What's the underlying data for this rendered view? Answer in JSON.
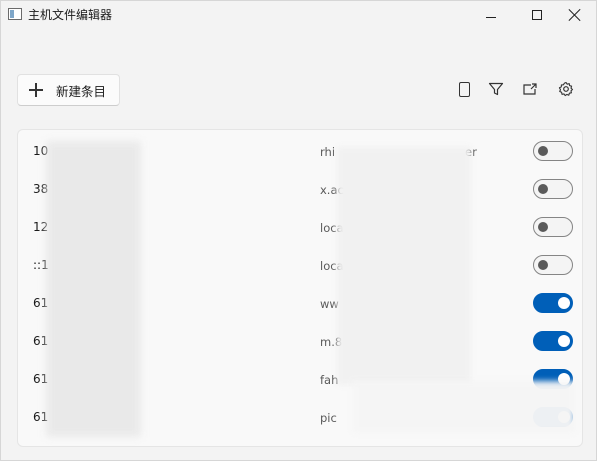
{
  "window": {
    "title": "主机文件编辑器"
  },
  "toolbar": {
    "new_entry_label": "新建条目",
    "icons": [
      "phone-icon",
      "filter-icon",
      "export-icon",
      "settings-icon"
    ]
  },
  "colors": {
    "accent": "#005fb8",
    "background": "#f3f3f3"
  },
  "entries": [
    {
      "ip": "10",
      "host": "rhi",
      "host_tail": "er",
      "enabled": false
    },
    {
      "ip": "38",
      "host": "x.ac",
      "enabled": false
    },
    {
      "ip": "12",
      "host": "loca",
      "enabled": false
    },
    {
      "ip": "::1",
      "host": "loca",
      "enabled": false
    },
    {
      "ip": "61",
      "host": "ww",
      "enabled": true
    },
    {
      "ip": "61",
      "host": "m.8",
      "enabled": true
    },
    {
      "ip": "61",
      "host": "fah",
      "enabled": true
    },
    {
      "ip": "61",
      "host": "pic",
      "enabled": true
    }
  ]
}
